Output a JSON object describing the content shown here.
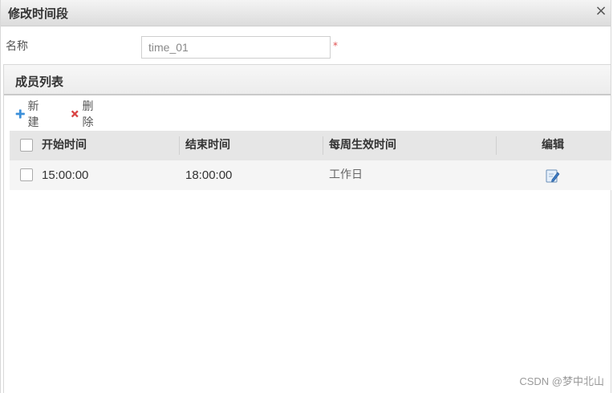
{
  "dialog": {
    "title": "修改时间段",
    "close_icon": "close-icon",
    "close_glyph": "×"
  },
  "form": {
    "name_label": "名称",
    "name_value": "time_01",
    "required_mark": "*"
  },
  "members": {
    "title": "成员列表",
    "toolbar": {
      "new_label": "新建",
      "delete_label": "删除"
    },
    "columns": [
      "开始时间",
      "结束时间",
      "每周生效时间",
      "编辑"
    ],
    "rows": [
      {
        "start": "15:00:00",
        "end": "18:00:00",
        "week": "工作日",
        "edit_icon": "edit-icon"
      }
    ]
  },
  "watermark": "CSDN @梦中北山",
  "colors": {
    "add_icon": "#3b8fd9",
    "delete_icon": "#e04343",
    "required": "#e05050"
  }
}
